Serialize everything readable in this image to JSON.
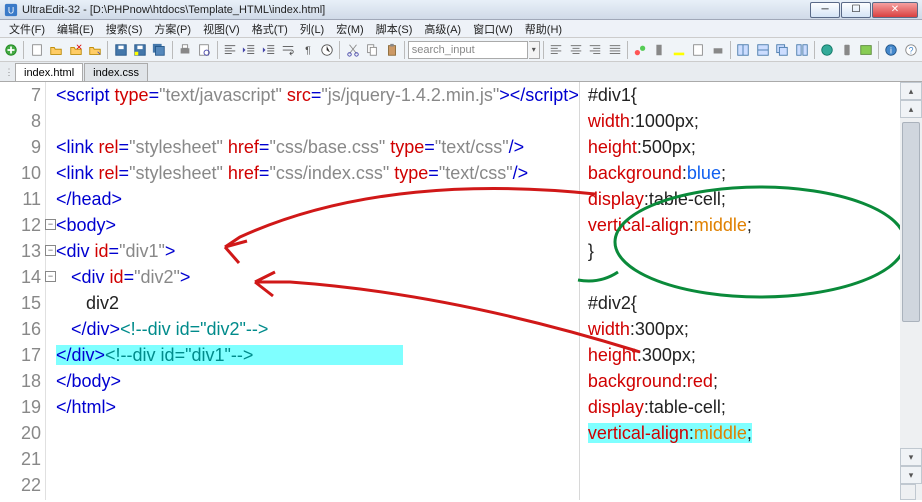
{
  "window": {
    "app": "UltraEdit-32",
    "path": "[D:\\PHPnow\\htdocs\\Template_HTML\\index.html]"
  },
  "menu": {
    "file": "文件(F)",
    "edit": "编辑(E)",
    "search": "搜索(S)",
    "project": "方案(P)",
    "view": "视图(V)",
    "format": "格式(T)",
    "column": "列(L)",
    "macro": "宏(M)",
    "script": "脚本(S)",
    "advanced": "高级(A)",
    "window": "窗口(W)",
    "help": "帮助(H)"
  },
  "toolbar": {
    "search_placeholder": "search_input"
  },
  "tabs": {
    "t0": "index.html",
    "t1": "index.css"
  },
  "lines": {
    "n7": "7",
    "n8": "8",
    "n9": "9",
    "n10": "10",
    "n11": "11",
    "n12": "12",
    "n13": "13",
    "n14": "14",
    "n15": "15",
    "n16": "16",
    "n17": "17",
    "n18": "18",
    "n19": "19",
    "n20": "20",
    "n21": "21",
    "n22": "22"
  },
  "code": {
    "l7": {
      "a": "<script ",
      "b": "type",
      "c": "=",
      "d": "\"text/javascript\" ",
      "e": "src",
      "f": "=",
      "g": "\"js/jquery-1.4.2.min.js\"",
      "h": ">",
      "i": "</",
      "j": "script",
      "k": ">"
    },
    "l9": {
      "a": "<link ",
      "b": "rel",
      "c": "=",
      "d": "\"stylesheet\" ",
      "e": "href",
      "f": "=",
      "g": "\"css/base.css\" ",
      "h": "type",
      "i": "=",
      "j": "\"text/css\"",
      "k": "/>"
    },
    "l10": {
      "a": "<link ",
      "b": "rel",
      "c": "=",
      "d": "\"stylesheet\" ",
      "e": "href",
      "f": "=",
      "g": "\"css/index.css\" ",
      "h": "type",
      "i": "=",
      "j": "\"text/css\"",
      "k": "/>"
    },
    "l11": {
      "a": "</head>"
    },
    "l12": {
      "a": "<body>"
    },
    "l13": {
      "a": "<div ",
      "b": "id",
      "c": "=",
      "d": "\"div1\"",
      "e": ">"
    },
    "l14": {
      "a": "<div ",
      "b": "id",
      "c": "=",
      "d": "\"div2\"",
      "e": ">"
    },
    "l15": {
      "a": "div2"
    },
    "l16": {
      "a": "</div>",
      "b": "<!--div id=\"div2\"-->"
    },
    "l17": {
      "a": "</div>",
      "b": "<!--div id=\"div1\"-->"
    },
    "l18": {
      "a": "</body>"
    },
    "l19": {
      "a": "</html>"
    }
  },
  "css": {
    "r1": {
      "sel": "#div1",
      "ob": "{"
    },
    "r2": {
      "p": "width",
      "v": ":1000px;"
    },
    "r3": {
      "p": "height",
      "v": ":500px;"
    },
    "r4": {
      "p": "background",
      "c": ":",
      "v": "blue",
      "e": ";"
    },
    "r5": {
      "p": "display",
      "v": ":table-cell;"
    },
    "r6": {
      "p": "vertical-align",
      "c": ":",
      "v": "middle",
      "e": ";"
    },
    "r7": {
      "cb": "}"
    },
    "r8": {
      "sel": "#div2",
      "ob": "{"
    },
    "r9": {
      "p": "width",
      "v": ":300px;"
    },
    "r10": {
      "p": "height",
      "v": ":300px;"
    },
    "r11": {
      "p": "background",
      "c": ":",
      "v": "red",
      "e": ";"
    },
    "r12": {
      "p": "display",
      "v": ":table-cell;"
    },
    "r13": {
      "p": "vertical-align",
      "c": ":",
      "v": "middle",
      "e": ";"
    }
  }
}
